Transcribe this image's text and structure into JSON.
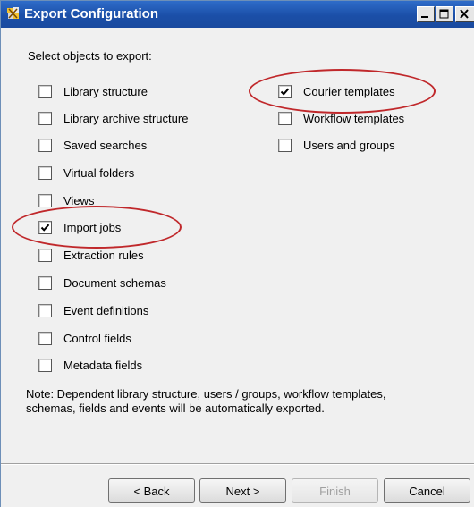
{
  "window": {
    "title": "Export Configuration"
  },
  "prompt": "Select objects to export:",
  "left_options": [
    {
      "label": "Library structure",
      "checked": false
    },
    {
      "label": "Library archive structure",
      "checked": false
    },
    {
      "label": "Saved searches",
      "checked": false
    },
    {
      "label": "Virtual folders",
      "checked": false
    },
    {
      "label": "Views",
      "checked": false
    },
    {
      "label": "Import jobs",
      "checked": true
    },
    {
      "label": "Extraction rules",
      "checked": false
    },
    {
      "label": "Document schemas",
      "checked": false
    },
    {
      "label": "Event definitions",
      "checked": false
    },
    {
      "label": "Control fields",
      "checked": false
    },
    {
      "label": "Metadata fields",
      "checked": false
    }
  ],
  "right_options": [
    {
      "label": "Courier templates",
      "checked": true
    },
    {
      "label": "Workflow templates",
      "checked": false
    },
    {
      "label": "Users and groups",
      "checked": false
    }
  ],
  "note": {
    "line1": "Note: Dependent library structure, users / groups, workflow templates,",
    "line2": "schemas, fields and events will be automatically exported."
  },
  "buttons": {
    "back": "< Back",
    "next": "Next >",
    "finish": "Finish",
    "cancel": "Cancel"
  },
  "colors": {
    "titlebar": "#1b4fa8",
    "annotation": "#c0282b",
    "dialog_bg": "#f0f0f0"
  }
}
